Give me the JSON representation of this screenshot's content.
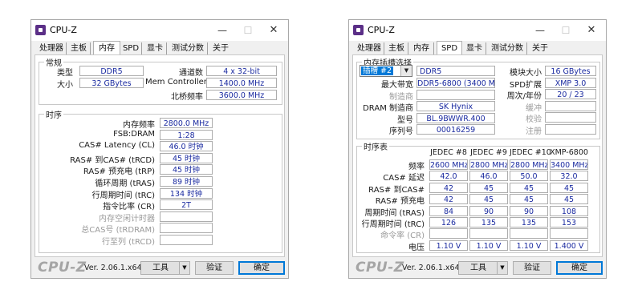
{
  "window1": {
    "title": "CPU-Z",
    "tabs": [
      "处理器",
      "主板",
      "内存",
      "SPD",
      "显卡",
      "测试分数",
      "关于"
    ],
    "active_tab": "内存",
    "general": {
      "label": "常规",
      "type_label": "类型",
      "type_value": "DDR5",
      "size_label": "大小",
      "size_value": "32 GBytes",
      "channels_label": "通道数",
      "channels_value": "4 x 32-bit",
      "memctrl_label": "Mem Controller",
      "memctrl_value": "1400.0 MHz",
      "northbridge_label": "北桥频率",
      "northbridge_value": "3600.0 MHz"
    },
    "timings": {
      "label": "时序",
      "rows": [
        {
          "label": "内存频率",
          "value": "2800.0 MHz",
          "dim": false
        },
        {
          "label": "FSB:DRAM",
          "value": "1:28",
          "dim": false
        },
        {
          "label": "CAS# Latency (CL)",
          "value": "46.0 时钟",
          "dim": false
        },
        {
          "label": "RAS# 到CAS# (tRCD)",
          "value": "45 时钟",
          "dim": false
        },
        {
          "label": "RAS# 预充电 (tRP)",
          "value": "45 时钟",
          "dim": false
        },
        {
          "label": "循环周期 (tRAS)",
          "value": "89 时钟",
          "dim": false
        },
        {
          "label": "行周期时间 (tRC)",
          "value": "134 时钟",
          "dim": false
        },
        {
          "label": "指令比率 (CR)",
          "value": "2T",
          "dim": false
        },
        {
          "label": "内存空闲计时器",
          "value": "",
          "dim": true
        },
        {
          "label": "总CAS号 (tRDRAM)",
          "value": "",
          "dim": true
        },
        {
          "label": "行至列 (tRCD)",
          "value": "",
          "dim": true
        }
      ]
    }
  },
  "window2": {
    "title": "CPU-Z",
    "tabs": [
      "处理器",
      "主板",
      "内存",
      "SPD",
      "显卡",
      "测试分数",
      "关于"
    ],
    "active_tab": "SPD",
    "slot": {
      "label": "内存插槽选择",
      "selected_slot": "插槽 #2",
      "type_value": "DDR5",
      "left_rows": [
        {
          "label": "最大带宽",
          "value": "DDR5-6800 (3400 MHz)",
          "dim": false
        },
        {
          "label": "制造商",
          "value": "",
          "dim": true
        },
        {
          "label": "DRAM 制造商",
          "value": "SK Hynix",
          "dim": false
        },
        {
          "label": "型号",
          "value": "BL.9BWWR.400",
          "dim": false
        },
        {
          "label": "序列号",
          "value": "00016259",
          "dim": false
        }
      ],
      "right_rows": [
        {
          "label": "模块大小",
          "value": "16 GBytes",
          "dim": false
        },
        {
          "label": "SPD扩展",
          "value": "XMP 3.0",
          "dim": false
        },
        {
          "label": "周次/年份",
          "value": "20 / 23",
          "dim": false
        },
        {
          "label": "缓冲",
          "value": "",
          "dim": true
        },
        {
          "label": "校验",
          "value": "",
          "dim": true
        },
        {
          "label": "注册",
          "value": "",
          "dim": true
        }
      ]
    },
    "timing_table": {
      "label": "时序表",
      "columns": [
        "JEDEC #8",
        "JEDEC #9",
        "JEDEC #10",
        "XMP-6800"
      ],
      "rows": [
        {
          "label": "频率",
          "values": [
            "2600 MHz",
            "2800 MHz",
            "2800 MHz",
            "3400 MHz"
          ],
          "dim": false
        },
        {
          "label": "CAS# 延迟",
          "values": [
            "42.0",
            "46.0",
            "50.0",
            "32.0"
          ],
          "dim": false
        },
        {
          "label": "RAS# 到CAS#",
          "values": [
            "42",
            "45",
            "45",
            "45"
          ],
          "dim": false
        },
        {
          "label": "RAS# 预充电",
          "values": [
            "42",
            "45",
            "45",
            "45"
          ],
          "dim": false
        },
        {
          "label": "周期时间 (tRAS)",
          "values": [
            "84",
            "90",
            "90",
            "108"
          ],
          "dim": false
        },
        {
          "label": "行周期时间 (tRC)",
          "values": [
            "126",
            "135",
            "135",
            "153"
          ],
          "dim": false
        },
        {
          "label": "命令率 (CR)",
          "values": [
            "",
            "",
            "",
            ""
          ],
          "dim": true
        },
        {
          "label": "电压",
          "values": [
            "1.10 V",
            "1.10 V",
            "1.10 V",
            "1.400 V"
          ],
          "dim": false
        }
      ]
    }
  },
  "footer": {
    "brand": "CPU-Z",
    "version": "Ver. 2.06.1.x64",
    "tools_label": "工具",
    "validate_label": "验证",
    "ok_label": "确定"
  },
  "icons": {
    "app": "cpu-z-app-icon",
    "minimize": "minimize-icon",
    "maximize": "maximize-icon",
    "close": "close-icon",
    "dropdown": "chevron-down-icon"
  },
  "colors": {
    "value_text": "#1a2aa0",
    "selection": "#0078d7",
    "app_icon": "#5b2f87"
  }
}
